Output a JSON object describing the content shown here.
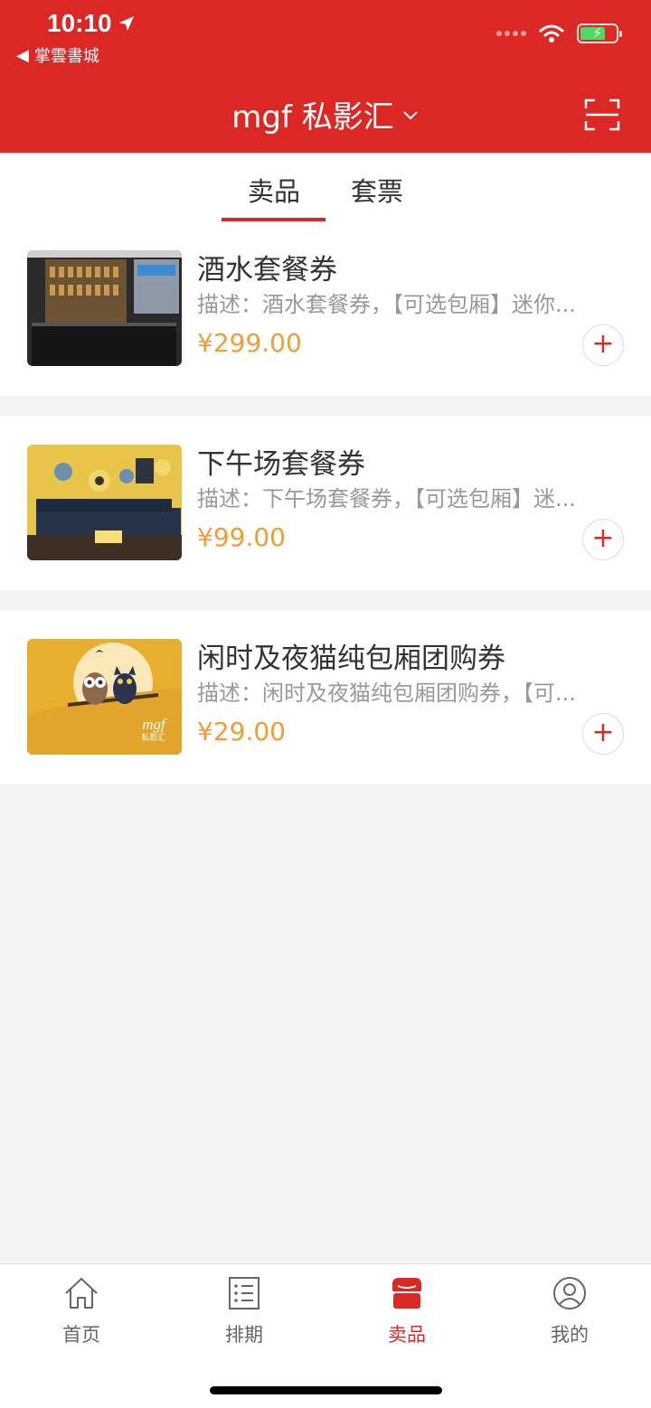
{
  "status_bar": {
    "time": "10:10",
    "back_label": "掌雲書城"
  },
  "header": {
    "store_name": "mgf 私影汇"
  },
  "tabs": [
    {
      "label": "卖品",
      "active": true
    },
    {
      "label": "套票",
      "active": false
    }
  ],
  "products": [
    {
      "title": "酒水套餐券",
      "description": "描述：酒水套餐券，【可选包厢】迷你...",
      "price": "¥299.00"
    },
    {
      "title": "下午场套餐券",
      "description": "描述：下午场套餐券，【可选包厢】迷...",
      "price": "¥99.00"
    },
    {
      "title": "闲时及夜猫纯包厢团购券",
      "description": "描述：闲时及夜猫纯包厢团购券，【可...",
      "price": "¥29.00"
    }
  ],
  "thumbnail_logo": {
    "brand": "mgf",
    "name": "私影汇"
  },
  "bottom_nav": [
    {
      "label": "首页",
      "icon": "home-icon"
    },
    {
      "label": "排期",
      "icon": "schedule-list-icon"
    },
    {
      "label": "卖品",
      "icon": "shop-icon",
      "active": true
    },
    {
      "label": "我的",
      "icon": "user-icon"
    }
  ],
  "colors": {
    "brand_red": "#dc2825",
    "price_orange": "#f39c35",
    "background": "#f4f4f4"
  }
}
